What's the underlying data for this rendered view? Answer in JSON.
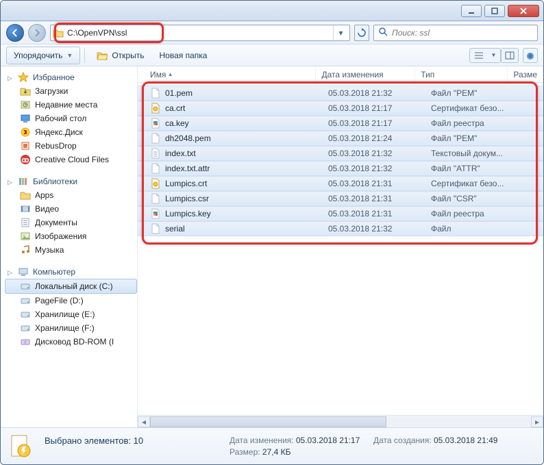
{
  "address_path": "C:\\OpenVPN\\ssl",
  "search": {
    "placeholder": "Поиск: ssl"
  },
  "toolbar": {
    "organize": "Упорядочить",
    "open": "Открыть",
    "new_folder": "Новая папка",
    "help": "?"
  },
  "columns": {
    "name": "Имя",
    "date": "Дата изменения",
    "type": "Тип",
    "size": "Разме"
  },
  "sidebar": {
    "favorites": {
      "label": "Избранное",
      "items": [
        {
          "label": "Загрузки",
          "icon": "downloads"
        },
        {
          "label": "Недавние места",
          "icon": "recent"
        },
        {
          "label": "Рабочий стол",
          "icon": "desktop"
        },
        {
          "label": "Яндекс.Диск",
          "icon": "yadisk"
        },
        {
          "label": "RebusDrop",
          "icon": "rebus"
        },
        {
          "label": "Creative Cloud Files",
          "icon": "cc"
        }
      ]
    },
    "libraries": {
      "label": "Библиотеки",
      "items": [
        {
          "label": "Apps",
          "icon": "folder"
        },
        {
          "label": "Видео",
          "icon": "video"
        },
        {
          "label": "Документы",
          "icon": "docs"
        },
        {
          "label": "Изображения",
          "icon": "images"
        },
        {
          "label": "Музыка",
          "icon": "music"
        }
      ]
    },
    "computer": {
      "label": "Компьютер",
      "items": [
        {
          "label": "Локальный диск (C:)",
          "icon": "hdd",
          "selected": true
        },
        {
          "label": "PageFile (D:)",
          "icon": "hdd"
        },
        {
          "label": "Хранилище (E:)",
          "icon": "hdd"
        },
        {
          "label": "Хранилище (F:)",
          "icon": "hdd"
        },
        {
          "label": "Дисковод BD-ROM (I",
          "icon": "bd"
        }
      ]
    }
  },
  "files": [
    {
      "name": "01.pem",
      "date": "05.03.2018 21:32",
      "type": "Файл \"PEM\"",
      "icon": "file"
    },
    {
      "name": "ca.crt",
      "date": "05.03.2018 21:17",
      "type": "Сертификат безо...",
      "icon": "cert"
    },
    {
      "name": "ca.key",
      "date": "05.03.2018 21:17",
      "type": "Файл реестра",
      "icon": "key"
    },
    {
      "name": "dh2048.pem",
      "date": "05.03.2018 21:24",
      "type": "Файл \"PEM\"",
      "icon": "file"
    },
    {
      "name": "index.txt",
      "date": "05.03.2018 21:32",
      "type": "Текстовый докум...",
      "icon": "txt"
    },
    {
      "name": "index.txt.attr",
      "date": "05.03.2018 21:32",
      "type": "Файл \"ATTR\"",
      "icon": "file"
    },
    {
      "name": "Lumpics.crt",
      "date": "05.03.2018 21:31",
      "type": "Сертификат безо...",
      "icon": "cert"
    },
    {
      "name": "Lumpics.csr",
      "date": "05.03.2018 21:31",
      "type": "Файл \"CSR\"",
      "icon": "file"
    },
    {
      "name": "Lumpics.key",
      "date": "05.03.2018 21:31",
      "type": "Файл реестра",
      "icon": "key"
    },
    {
      "name": "serial",
      "date": "05.03.2018 21:32",
      "type": "Файл",
      "icon": "file"
    }
  ],
  "status": {
    "title": "Выбрано элементов: 10",
    "date_mod_label": "Дата изменения:",
    "date_mod_value": "05.03.2018 21:17",
    "size_label": "Размер:",
    "size_value": "27,4 КБ",
    "date_created_label": "Дата создания:",
    "date_created_value": "05.03.2018 21:49"
  }
}
